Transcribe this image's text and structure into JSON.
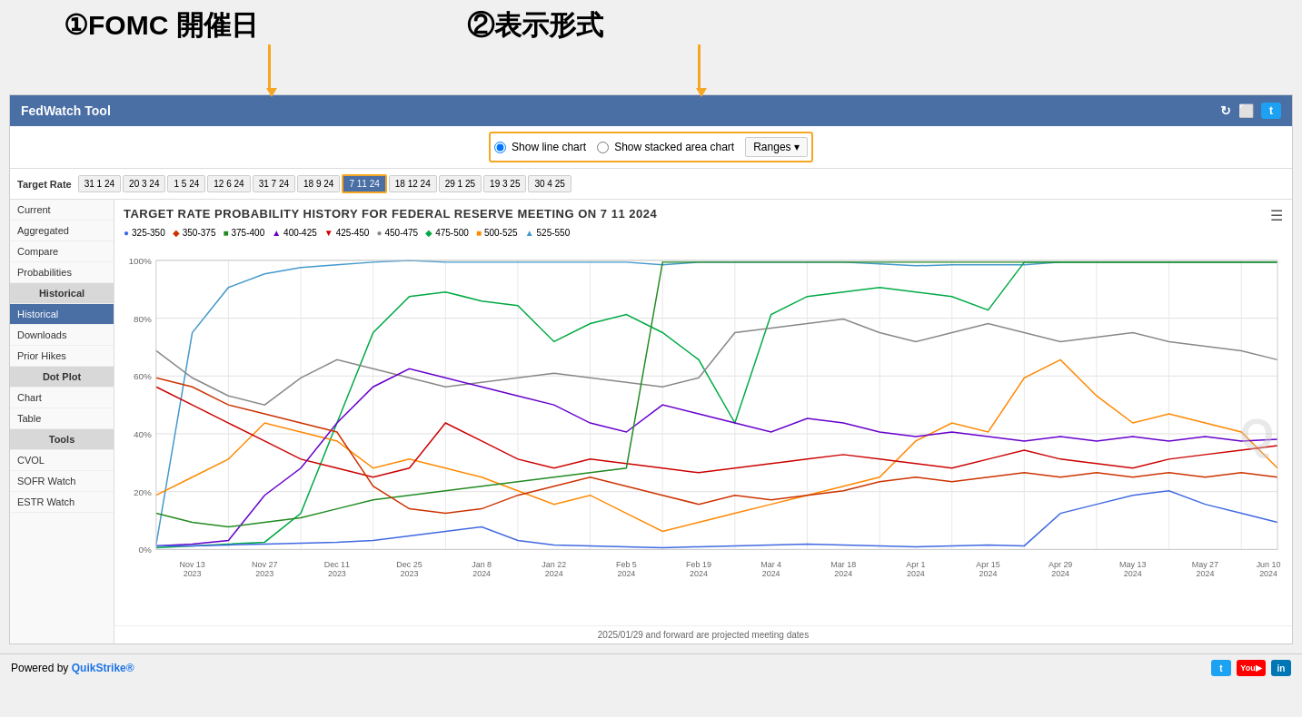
{
  "annotations": {
    "label1": "①FOMC 開催日",
    "label2": "②表示形式"
  },
  "header": {
    "title": "FedWatch Tool",
    "refresh_icon": "↻",
    "expand_icon": "⊞",
    "twitter_icon": "🐦"
  },
  "chart_controls": {
    "radio1_label": "Show line chart",
    "radio2_label": "Show stacked area chart",
    "ranges_btn": "Ranges ▾"
  },
  "target_rate": {
    "label": "Target Rate",
    "dates": [
      {
        "label": "31 1 24",
        "active": false
      },
      {
        "label": "20 3 24",
        "active": false
      },
      {
        "label": "1 5 24",
        "active": false
      },
      {
        "label": "12 6 24",
        "active": false
      },
      {
        "label": "31 7 24",
        "active": false
      },
      {
        "label": "18 9 24",
        "active": false
      },
      {
        "label": "7 11 24",
        "active": true
      },
      {
        "label": "18 12 24",
        "active": false
      },
      {
        "label": "29 1 25",
        "active": false
      },
      {
        "label": "19 3 25",
        "active": false
      },
      {
        "label": "30 4 25",
        "active": false
      }
    ]
  },
  "sidebar": {
    "sections": [
      {
        "type": "header",
        "label": "Current"
      },
      {
        "type": "item",
        "label": "Aggregated"
      },
      {
        "type": "item",
        "label": "Compare"
      },
      {
        "type": "item",
        "label": "Probabilities"
      },
      {
        "type": "section-header",
        "label": "Historical"
      },
      {
        "type": "item",
        "label": "Historical",
        "active": true
      },
      {
        "type": "item",
        "label": "Downloads"
      },
      {
        "type": "item",
        "label": "Prior Hikes"
      },
      {
        "type": "section-header",
        "label": "Dot Plot"
      },
      {
        "type": "item",
        "label": "Chart"
      },
      {
        "type": "item",
        "label": "Table"
      },
      {
        "type": "section-header",
        "label": "Tools"
      },
      {
        "type": "item",
        "label": "CVOL"
      },
      {
        "type": "item",
        "label": "SOFR Watch"
      },
      {
        "type": "item",
        "label": "ESTR Watch"
      }
    ]
  },
  "chart": {
    "title": "TARGET RATE PROBABILITY HISTORY FOR FEDERAL RESERVE MEETING ON 7 11 2024",
    "footer": "2025/01/29 and forward are projected meeting dates",
    "watermark": "Q",
    "legend": [
      {
        "label": "325-350",
        "color": "#4169e1",
        "shape": "circle"
      },
      {
        "label": "350-375",
        "color": "#cc3300",
        "shape": "diamond"
      },
      {
        "label": "375-400",
        "color": "#228b22",
        "shape": "square"
      },
      {
        "label": "400-425",
        "color": "#6600cc",
        "shape": "triangle"
      },
      {
        "label": "425-450",
        "color": "#cc0000",
        "shape": "triangle-down"
      },
      {
        "label": "450-475",
        "color": "#888888",
        "shape": "circle"
      },
      {
        "label": "475-500",
        "color": "#00aa44",
        "shape": "diamond"
      },
      {
        "label": "500-525",
        "color": "#ff8800",
        "shape": "square"
      },
      {
        "label": "525-550",
        "color": "#4499cc",
        "shape": "triangle"
      }
    ],
    "y_labels": [
      "100%",
      "80%",
      "60%",
      "40%",
      "20%",
      "0%"
    ],
    "x_labels": [
      {
        "label": "Nov 13",
        "sub": "2023"
      },
      {
        "label": "Nov 27",
        "sub": "2023"
      },
      {
        "label": "Dec 11",
        "sub": "2023"
      },
      {
        "label": "Dec 25",
        "sub": "2023"
      },
      {
        "label": "Jan 8",
        "sub": "2024"
      },
      {
        "label": "Jan 22",
        "sub": "2024"
      },
      {
        "label": "Feb 5",
        "sub": "2024"
      },
      {
        "label": "Feb 19",
        "sub": "2024"
      },
      {
        "label": "Mar 4",
        "sub": "2024"
      },
      {
        "label": "Mar 18",
        "sub": "2024"
      },
      {
        "label": "Apr 1",
        "sub": "2024"
      },
      {
        "label": "Apr 15",
        "sub": "2024"
      },
      {
        "label": "Apr 29",
        "sub": "2024"
      },
      {
        "label": "May 13",
        "sub": "2024"
      },
      {
        "label": "May 27",
        "sub": "2024"
      },
      {
        "label": "Jun 10",
        "sub": "2024"
      }
    ]
  },
  "bottom_bar": {
    "powered_by": "Powered by",
    "brand": "QuikStrike®"
  }
}
